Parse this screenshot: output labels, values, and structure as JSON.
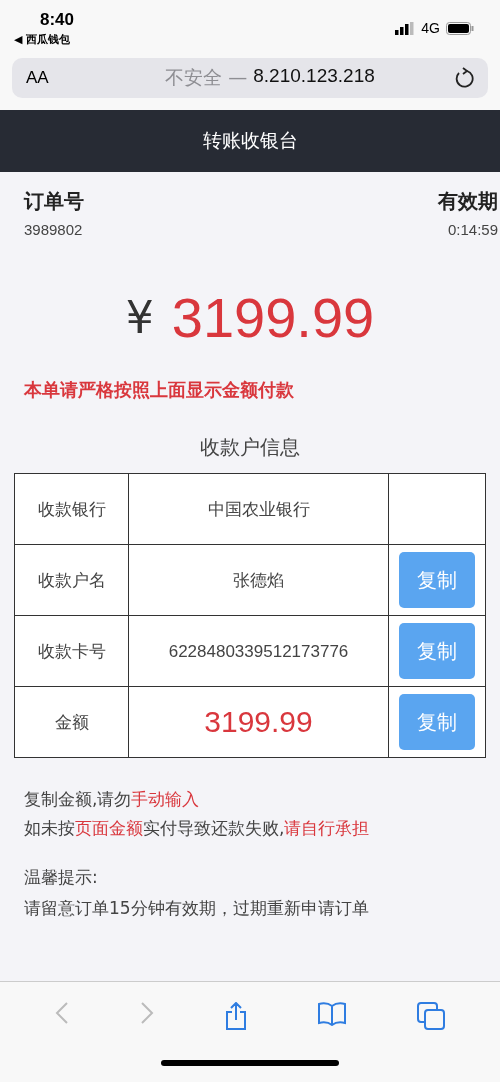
{
  "status_bar": {
    "time": "8:40",
    "back_app": "◀ 西瓜钱包",
    "network": "4G"
  },
  "address_bar": {
    "text_size": "AA",
    "security": "不安全 —",
    "url": "8.210.123.218"
  },
  "header": {
    "title": "转账收银台"
  },
  "order": {
    "number_label": "订单号",
    "number": "3989802",
    "expiry_label": "有效期",
    "expiry": "0:14:59"
  },
  "amount": {
    "currency": "¥",
    "value": "3199.99"
  },
  "warning": "本单请严格按照上面显示金额付款",
  "payee": {
    "title": "收款户信息",
    "rows": [
      {
        "label": "收款银行",
        "value": "中国农业银行",
        "kind": "plain"
      },
      {
        "label": "收款户名",
        "value": "张德焰",
        "kind": "plain",
        "copy": "复制"
      },
      {
        "label": "收款卡号",
        "value": "6228480339512173776",
        "kind": "plain",
        "copy": "复制"
      },
      {
        "label": "金额",
        "value": "3199.99",
        "kind": "amount",
        "copy": "复制"
      }
    ]
  },
  "notes": [
    [
      {
        "text": "复制金额,请勿",
        "highlight": false
      },
      {
        "text": "手动输入",
        "highlight": true
      }
    ],
    [
      {
        "text": "如未按",
        "highlight": false
      },
      {
        "text": "页面金额",
        "highlight": true
      },
      {
        "text": "实付导致还款失败,",
        "highlight": false
      },
      {
        "text": "请自行承担",
        "highlight": true
      }
    ]
  ],
  "tips": {
    "title": "温馨提示:",
    "text": "请留意订单15分钟有效期，过期重新申请订单"
  }
}
